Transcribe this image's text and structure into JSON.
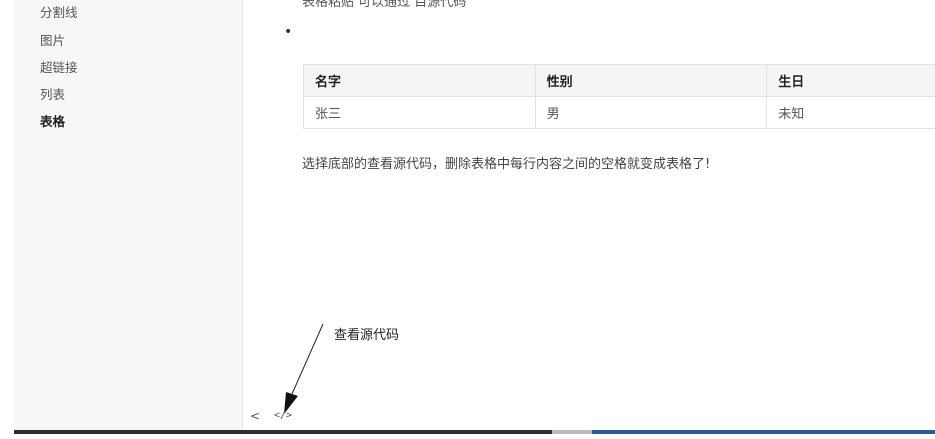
{
  "sidebar": {
    "items": [
      {
        "label": "分割线",
        "active": false
      },
      {
        "label": "图片",
        "active": false
      },
      {
        "label": "超链接",
        "active": false
      },
      {
        "label": "列表",
        "active": false
      },
      {
        "label": "表格",
        "active": true
      }
    ]
  },
  "content": {
    "cut_off_text": "表格粘贴 可以通过 目源代码",
    "bullet": "•",
    "table": {
      "headers": [
        "名字",
        "性别",
        "生日"
      ],
      "rows": [
        [
          "张三",
          "男",
          "未知"
        ]
      ]
    },
    "paragraph": "选择底部的查看源代码，删除表格中每行内容之间的空格就变成表格了!"
  },
  "annotation": {
    "label": "查看源代码"
  },
  "footer": {
    "prev_glyph": "<",
    "code_glyph": "</>"
  },
  "colors": {
    "sidebar_bg": "#f7f7f7",
    "table_header_bg": "#f5f5f5",
    "bottom_bar_dark": "#2f2f2f",
    "bottom_bar_blue": "#2a5b9a"
  }
}
